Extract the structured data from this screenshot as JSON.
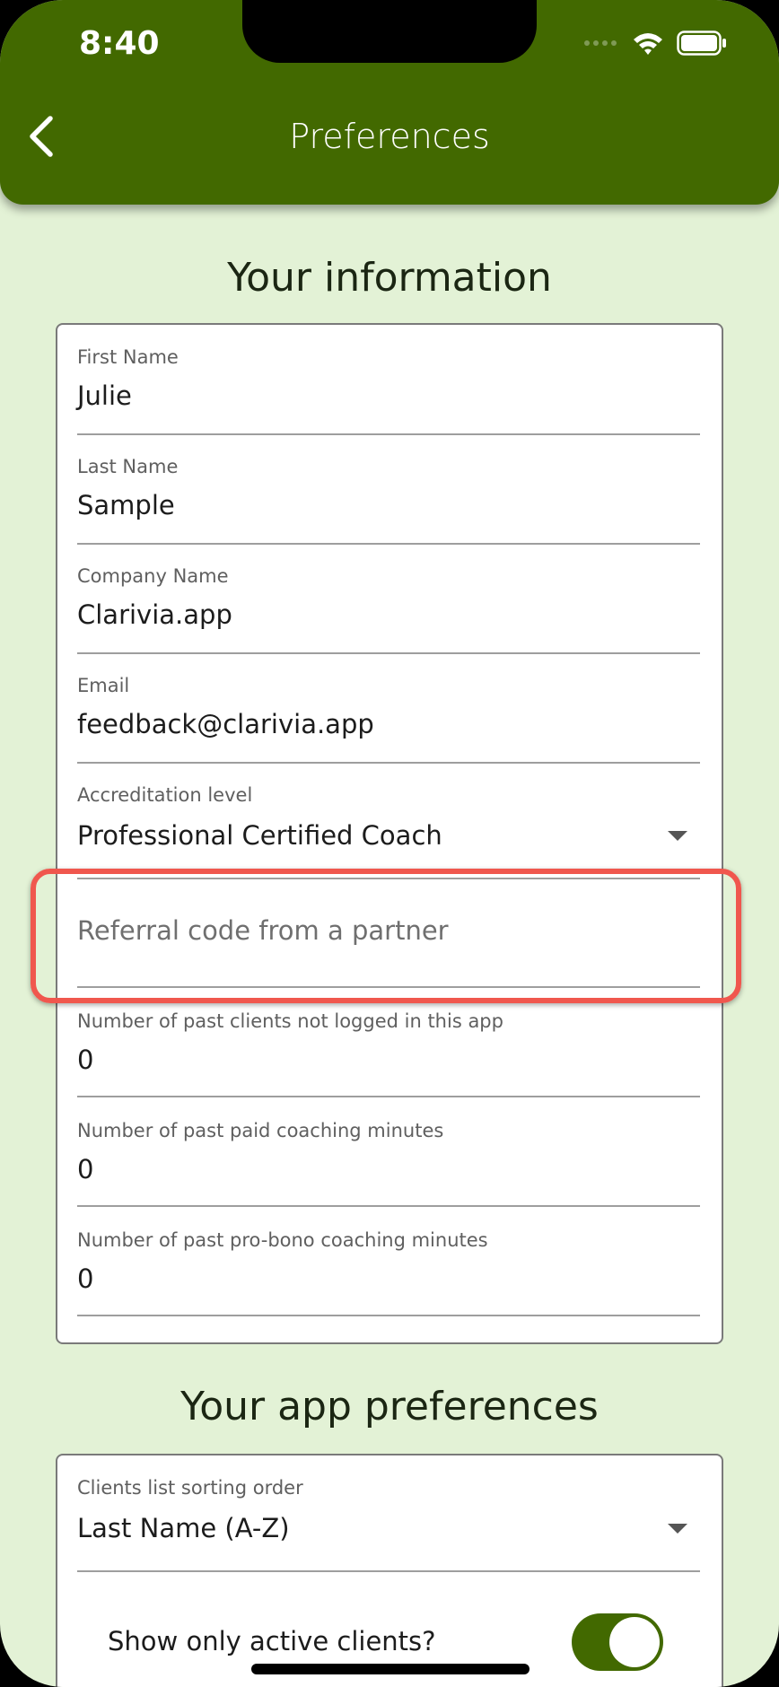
{
  "status_bar": {
    "time": "8:40"
  },
  "header": {
    "title": "Preferences"
  },
  "sections": {
    "info_title": "Your information",
    "prefs_title": "Your app preferences"
  },
  "info_fields": {
    "first_name": {
      "label": "First Name",
      "value": "Julie"
    },
    "last_name": {
      "label": "Last Name",
      "value": "Sample"
    },
    "company": {
      "label": "Company Name",
      "value": "Clarivia.app"
    },
    "email": {
      "label": "Email",
      "value": "feedback@clarivia.app"
    },
    "accreditation": {
      "label": "Accreditation level",
      "value": "Professional Certified Coach"
    },
    "referral": {
      "placeholder": "Referral code from a partner"
    },
    "past_clients": {
      "label": "Number of past clients not logged in this app",
      "value": "0"
    },
    "paid_minutes": {
      "label": "Number of past paid coaching minutes",
      "value": "0"
    },
    "probono_minutes": {
      "label": "Number of past pro-bono coaching minutes",
      "value": "0"
    }
  },
  "prefs": {
    "sort_order": {
      "label": "Clients list sorting order",
      "value": "Last Name (A-Z)"
    },
    "active_only": {
      "label": "Show only active clients?",
      "enabled": true
    }
  },
  "colors": {
    "brand": "#426900",
    "background": "#e3f2d6",
    "highlight": "#f0574e"
  }
}
